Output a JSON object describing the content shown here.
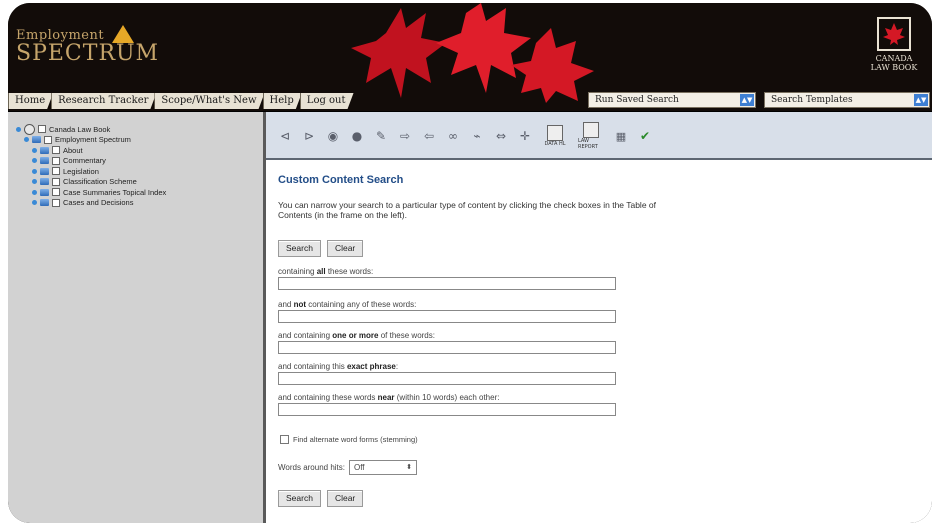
{
  "header": {
    "logo_top": "Employment",
    "logo_main": "SPECTRUM",
    "right_logo": [
      "CANADA",
      "LAW BOOK"
    ]
  },
  "nav": {
    "tabs": [
      "Home",
      "Research Tracker",
      "Scope/What's New",
      "Help",
      "Log out"
    ],
    "saved_search": "Run Saved Search",
    "search_templates": "Search Templates"
  },
  "tree": {
    "items": [
      {
        "label": "Canada Law Book",
        "level": 0
      },
      {
        "label": "Employment Spectrum",
        "level": 1
      },
      {
        "label": "About",
        "level": 2
      },
      {
        "label": "Commentary",
        "level": 2
      },
      {
        "label": "Legislation",
        "level": 2
      },
      {
        "label": "Classification Scheme",
        "level": 2
      },
      {
        "label": "Case Summaries Topical Index",
        "level": 2
      },
      {
        "label": "Cases and Decisions",
        "level": 2
      }
    ]
  },
  "toolbar": {
    "icons": [
      "search-prev-icon",
      "search-next-icon",
      "radio-icon",
      "radio-filled-icon",
      "pencil-icon",
      "forward-icon",
      "back-icon",
      "link-icon",
      "unlink-icon",
      "arrows-icon",
      "move-icon"
    ],
    "big_icons": [
      "DATA HL",
      "LAW REPORT"
    ]
  },
  "main": {
    "title": "Custom Content Search",
    "intro": "You can narrow your search to a particular type of content by clicking the check boxes in the Table of Contents (in the frame on the left).",
    "search_label": "Search",
    "clear_label": "Clear",
    "fields": [
      {
        "pre": "containing ",
        "bold": "all",
        "post": " these words:"
      },
      {
        "pre": "and ",
        "bold": "not",
        "post": " containing any of these words:"
      },
      {
        "pre": "and containing ",
        "bold": "one or more",
        "post": " of these words:"
      },
      {
        "pre": "and containing this ",
        "bold": "exact phrase",
        "post": ":"
      },
      {
        "pre": "and containing these words ",
        "bold": "near",
        "post": " (within 10 words) each other:"
      }
    ],
    "stemming_label": "Find alternate word forms (stemming)",
    "words_around_label": "Words around hits:",
    "words_around_value": "Off"
  }
}
